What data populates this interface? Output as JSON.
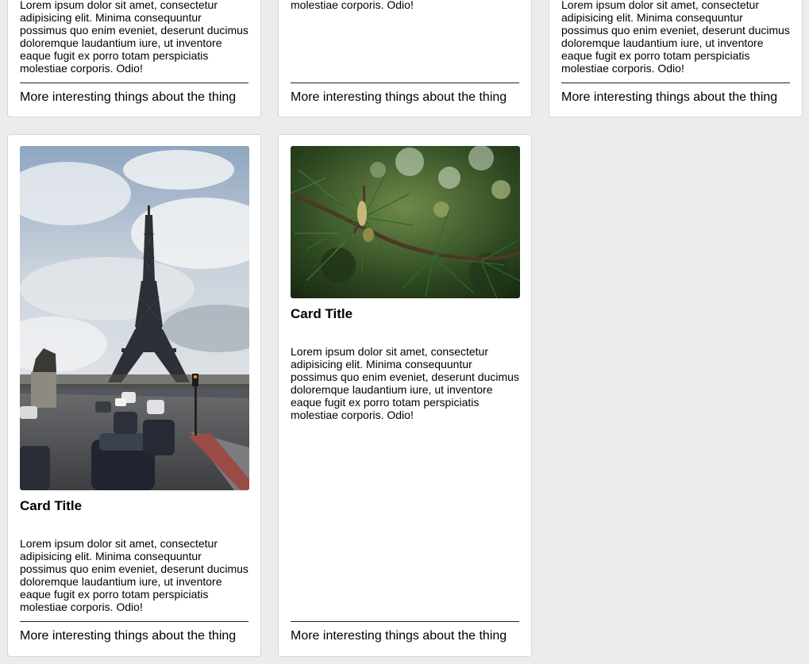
{
  "cards": [
    {
      "title": "",
      "text": "Lorem ipsum dolor sit amet, consectetur adipisicing elit. Minima consequuntur possimus quo enim eveniet, deserunt ducimus doloremque laudantium iure, ut inventore eaque fugit ex porro totam perspiciatis molestiae corporis. Odio!",
      "footer": "More interesting things about the thing"
    },
    {
      "title": "",
      "text": "Lorem ipsum dolor sit amet, consectetur adipisicing elit. Minima consequuntur possimus quo enim eveniet, deserunt ducimus doloremque laudantium iure, ut inventore eaque fugit ex porro totam perspiciatis molestiae corporis. Odio!",
      "footer": "More interesting things about the thing"
    },
    {
      "title": "",
      "text": "Lorem ipsum dolor sit amet, consectetur adipisicing elit. Minima consequuntur possimus quo enim eveniet, deserunt ducimus doloremque laudantium iure, ut inventore eaque fugit ex porro totam perspiciatis molestiae corporis. Odio!",
      "footer": "More interesting things about the thing"
    },
    {
      "image": "eiffel-tower-photo",
      "title": "Card Title",
      "text": "Lorem ipsum dolor sit amet, consectetur adipisicing elit. Minima consequuntur possimus quo enim eveniet, deserunt ducimus doloremque laudantium iure, ut inventore eaque fugit ex porro totam perspiciatis molestiae corporis. Odio!",
      "footer": "More interesting things about the thing"
    },
    {
      "image": "pine-branch-photo",
      "title": "Card Title",
      "text": "Lorem ipsum dolor sit amet, consectetur adipisicing elit. Minima consequuntur possimus quo enim eveniet, deserunt ducimus doloremque laudantium iure, ut inventore eaque fugit ex porro totam perspiciatis molestiae corporis. Odio!",
      "footer": "More interesting things about the thing"
    }
  ],
  "colors": {
    "page_background": "#ececec",
    "card_background": "#ffffff",
    "card_border": "#d6d6d6"
  }
}
